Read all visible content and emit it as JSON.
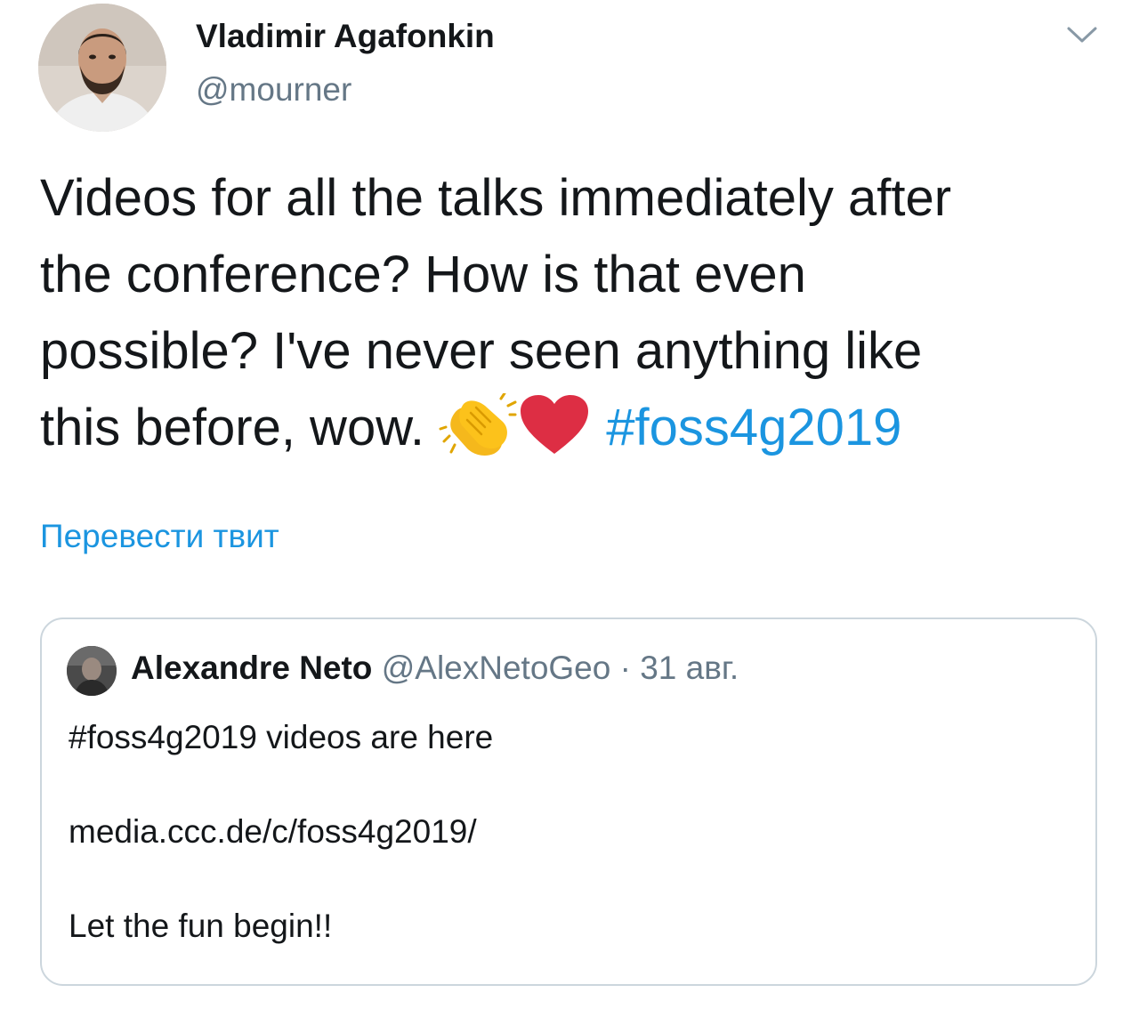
{
  "author": {
    "name": "Vladimir Agafonkin",
    "handle": "@mourner"
  },
  "tweet": {
    "text_line_1": "Videos for all the talks immediately after",
    "text_line_2": "the conference? How is that even",
    "text_line_3": "possible? I've never seen anything like",
    "text_line_4_prefix": "this before, wow.",
    "emoji_1": "clapping-hands-icon",
    "emoji_2": "red-heart-icon",
    "hashtag": "#foss4g2019"
  },
  "translate_label": "Перевести твит",
  "quoted_tweet": {
    "author_name": "Alexandre Neto",
    "author_handle": "@AlexNetoGeo",
    "separator": " · ",
    "date": "31 авг.",
    "line_1": "#foss4g2019 videos are here",
    "line_2": "media.ccc.de/c/foss4g2019/",
    "line_3": "Let the fun begin!!"
  },
  "colors": {
    "text": "#14171a",
    "secondary": "#657786",
    "link": "#1b95e0",
    "border": "#ccd6dd",
    "heart": "#dd2e44",
    "clap": "#fcc21b"
  }
}
